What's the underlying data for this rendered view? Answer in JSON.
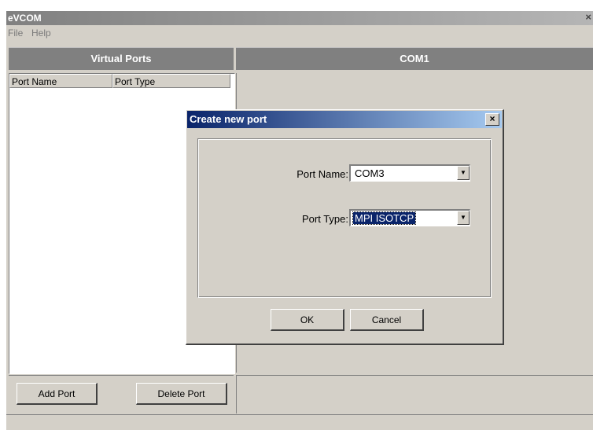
{
  "app": {
    "title": "eVCOM",
    "close_glyph": "×"
  },
  "menu": {
    "file": "File",
    "help": "Help"
  },
  "left_panel": {
    "title": "Virtual Ports",
    "columns": [
      "Port Name",
      "Port Type"
    ],
    "add_button": "Add Port",
    "delete_button": "Delete Port"
  },
  "right_panel": {
    "title": "COM1"
  },
  "dialog": {
    "title": "Create new port",
    "close_glyph": "×",
    "port_name_label": "Port Name:",
    "port_name_value": "COM3",
    "port_type_label": "Port Type:",
    "port_type_value": "MPI ISOTCP",
    "ok_button": "OK",
    "cancel_button": "Cancel",
    "dropdown_icon": "▼"
  },
  "colors": {
    "dialog_title_start": "#0a246a",
    "dialog_title_end": "#a6caf0",
    "panel_header": "#808080",
    "window_bg": "#d4d0c8"
  }
}
